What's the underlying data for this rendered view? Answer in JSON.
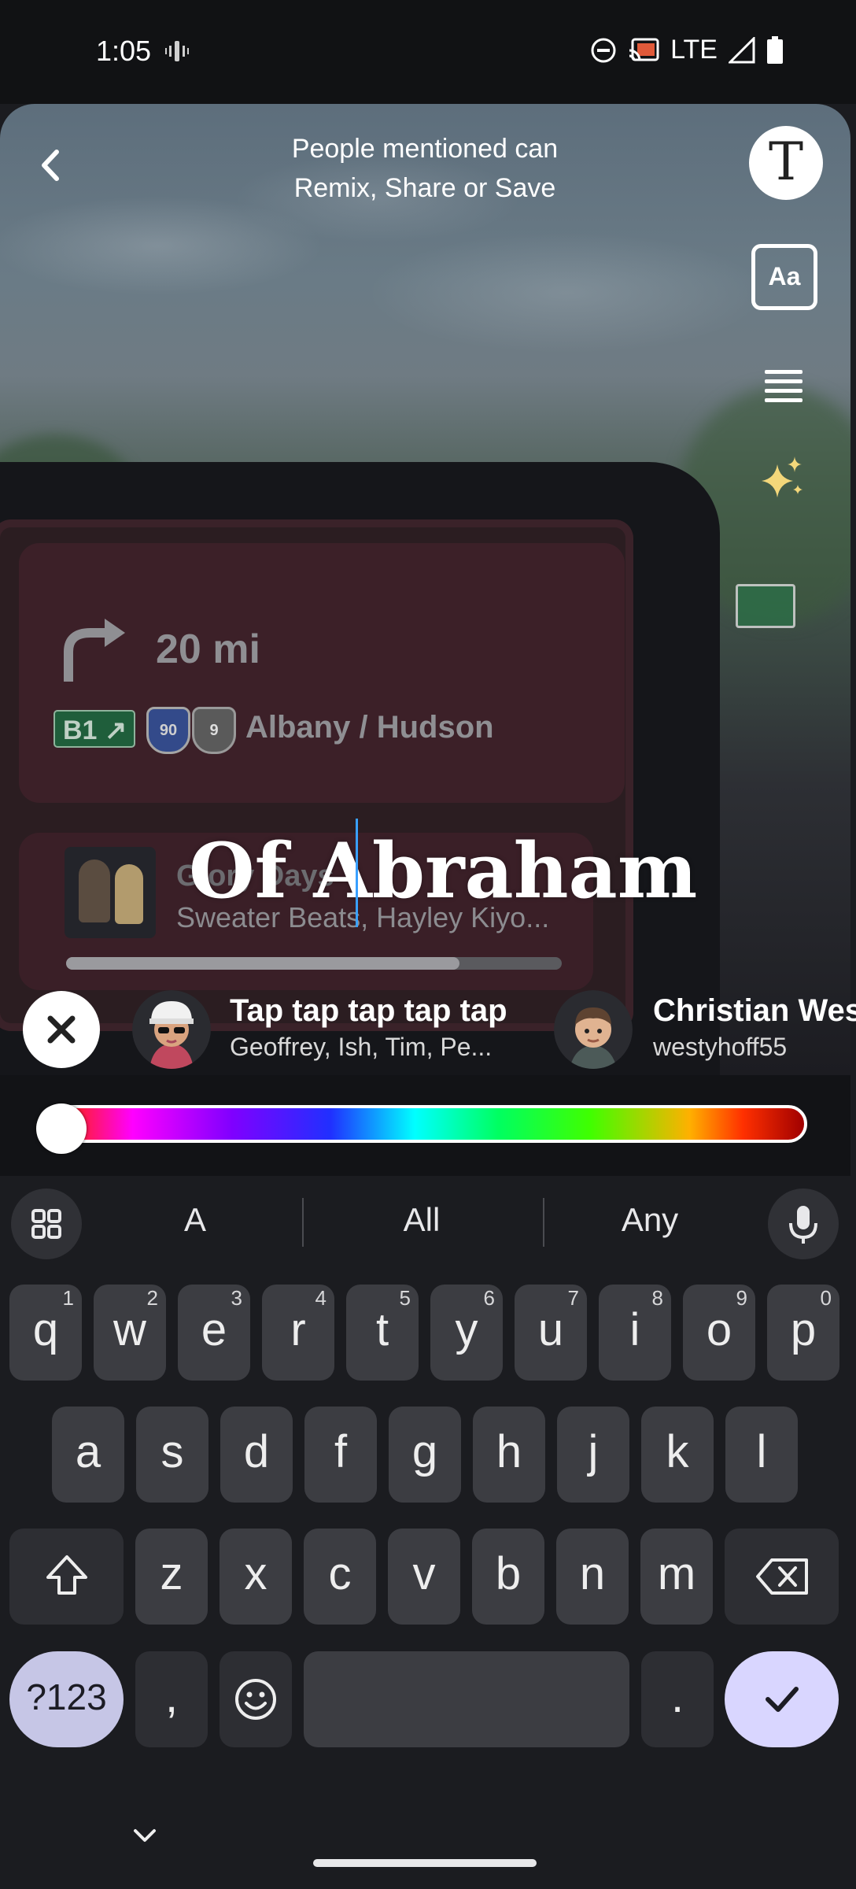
{
  "status_bar": {
    "time": "1:05",
    "network": "LTE",
    "icons": [
      "vibrate-icon",
      "do-not-disturb-icon",
      "cast-icon",
      "signal-icon",
      "battery-icon"
    ]
  },
  "top_bar": {
    "mention_hint_line1": "People mentioned can",
    "mention_hint_line2": "Remix, Share or Save"
  },
  "tools": {
    "text_tool": "T",
    "font_tool": "Aa",
    "align_tool": "align-icon",
    "effects_tool": "sparkle-icon"
  },
  "background_scene": {
    "nav_distance": "20 mi",
    "nav_exit": "B1",
    "nav_shield_1": "90",
    "nav_shield_2": "9",
    "nav_road": "Albany / Hudson",
    "song_title_partial": "Glory Days",
    "song_artist": "Sweater Beats, Hayley Kiyo..."
  },
  "caption": {
    "text": "Of Abraham"
  },
  "mention_suggestions": {
    "items": [
      {
        "title": "Tap tap tap tap tap",
        "subtitle": "Geoffrey, Ish, Tim, Pe..."
      },
      {
        "title": "Christian Wes",
        "subtitle": "westyhoff55"
      }
    ]
  },
  "color_slider": {
    "selected_color": "#ffffff",
    "value": 0.0
  },
  "keyboard": {
    "suggestions": [
      "A",
      "All",
      "Any"
    ],
    "row1": [
      {
        "k": "q",
        "n": "1"
      },
      {
        "k": "w",
        "n": "2"
      },
      {
        "k": "e",
        "n": "3"
      },
      {
        "k": "r",
        "n": "4"
      },
      {
        "k": "t",
        "n": "5"
      },
      {
        "k": "y",
        "n": "6"
      },
      {
        "k": "u",
        "n": "7"
      },
      {
        "k": "i",
        "n": "8"
      },
      {
        "k": "o",
        "n": "9"
      },
      {
        "k": "p",
        "n": "0"
      }
    ],
    "row2": [
      "a",
      "s",
      "d",
      "f",
      "g",
      "h",
      "j",
      "k",
      "l"
    ],
    "row3": [
      "z",
      "x",
      "c",
      "v",
      "b",
      "n",
      "m"
    ],
    "symbols_label": "?123",
    "comma": ",",
    "period": "."
  },
  "colors": {
    "accent": "#d9d6ff",
    "symbols_key": "#c6c6e6",
    "cursor": "#39a0ff"
  }
}
